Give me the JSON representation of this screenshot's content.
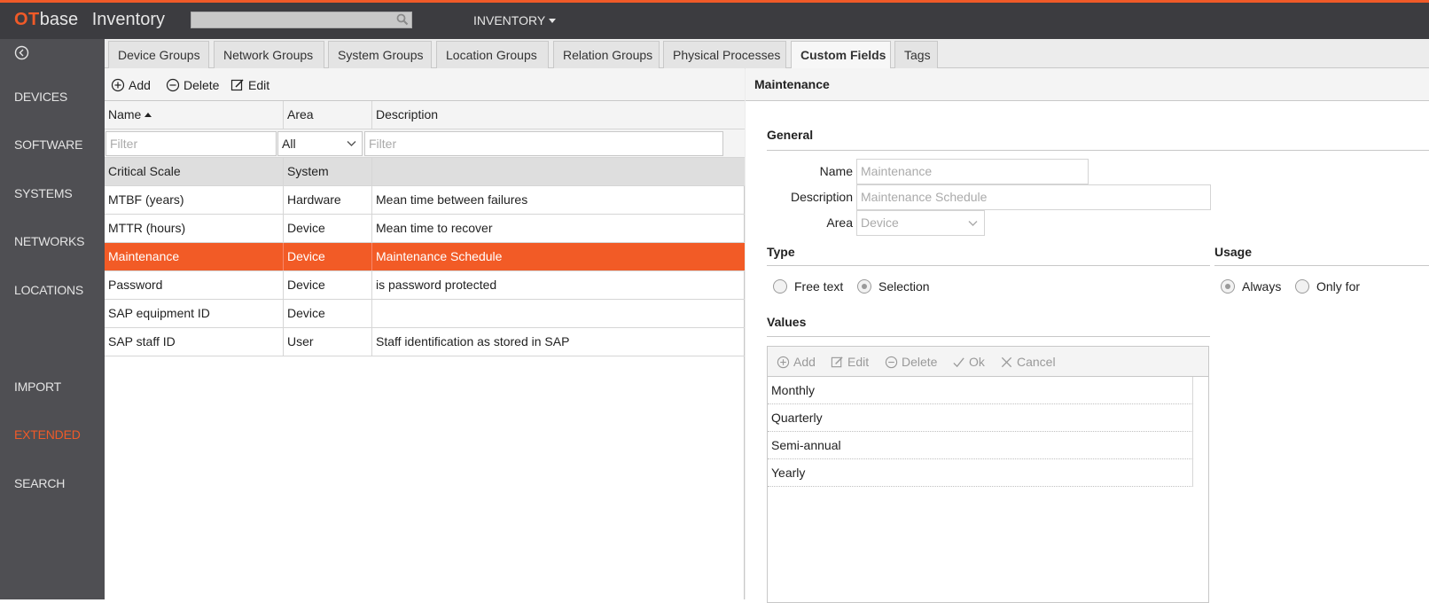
{
  "app": {
    "logo_ot": "OT",
    "logo_base": "base",
    "title": "Inventory",
    "search_placeholder": "",
    "top_menu": "INVENTORY"
  },
  "sidebar": {
    "items": [
      {
        "label": "DEVICES",
        "active": false
      },
      {
        "label": "SOFTWARE",
        "active": false
      },
      {
        "label": "SYSTEMS",
        "active": false
      },
      {
        "label": "NETWORKS",
        "active": false
      },
      {
        "label": "LOCATIONS",
        "active": false
      },
      {
        "label": "IMPORT",
        "active": false
      },
      {
        "label": "EXTENDED",
        "active": true
      },
      {
        "label": "SEARCH",
        "active": false
      }
    ]
  },
  "tabs": [
    {
      "label": "Device Groups"
    },
    {
      "label": "Network Groups"
    },
    {
      "label": "System Groups"
    },
    {
      "label": "Location Groups"
    },
    {
      "label": "Relation Groups"
    },
    {
      "label": "Physical Processes"
    },
    {
      "label": "Custom Fields",
      "active": true
    },
    {
      "label": "Tags"
    }
  ],
  "toolbar": {
    "add": "Add",
    "delete": "Delete",
    "edit": "Edit"
  },
  "grid": {
    "columns": [
      "Name",
      "Area",
      "Description"
    ],
    "filter_name_placeholder": "Filter",
    "filter_area_value": "All",
    "filter_desc_placeholder": "Filter",
    "rows": [
      {
        "name": "Critical Scale",
        "area": "System",
        "description": ""
      },
      {
        "name": "MTBF (years)",
        "area": "Hardware",
        "description": "Mean time between failures"
      },
      {
        "name": "MTTR (hours)",
        "area": "Device",
        "description": "Mean time to recover"
      },
      {
        "name": "Maintenance",
        "area": "Device",
        "description": "Maintenance Schedule"
      },
      {
        "name": "Password",
        "area": "Device",
        "description": "is password protected"
      },
      {
        "name": "SAP equipment ID",
        "area": "Device",
        "description": ""
      },
      {
        "name": "SAP staff ID",
        "area": "User",
        "description": "Staff identification as stored in SAP"
      }
    ]
  },
  "detail": {
    "title": "Maintenance",
    "general_title": "General",
    "name_label": "Name",
    "name_value": "Maintenance",
    "description_label": "Description",
    "description_value": "Maintenance Schedule",
    "area_label": "Area",
    "area_value": "Device",
    "type_title": "Type",
    "type_options": [
      "Free text",
      "Selection"
    ],
    "type_selected": "Selection",
    "usage_title": "Usage",
    "usage_options": [
      "Always",
      "Only for"
    ],
    "usage_selected": "Always",
    "values_title": "Values",
    "values_toolbar": {
      "add": "Add",
      "edit": "Edit",
      "delete": "Delete",
      "ok": "Ok",
      "cancel": "Cancel"
    },
    "values": [
      "Monthly",
      "Quarterly",
      "Semi-annual",
      "Yearly"
    ]
  },
  "colors": {
    "accent": "#f05a28",
    "selected_row": "#f25b26",
    "topbar": "#3c3c40",
    "sidebar": "#4f4f53"
  }
}
